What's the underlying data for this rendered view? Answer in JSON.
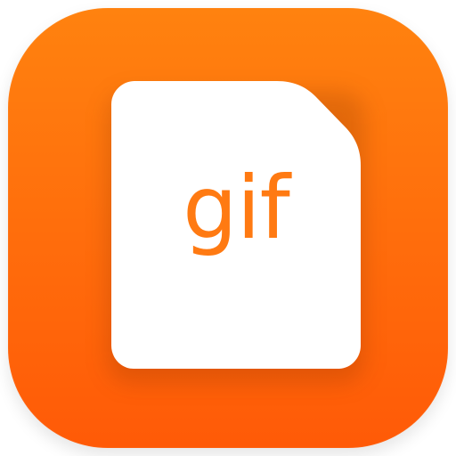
{
  "app_icon": {
    "label": "gif",
    "icon_name": "gif-file-icon",
    "colors": {
      "tile_top": "#ff820f",
      "tile_bottom": "#ff5a07",
      "document": "#ffffff",
      "label": "#ff7a12"
    }
  }
}
